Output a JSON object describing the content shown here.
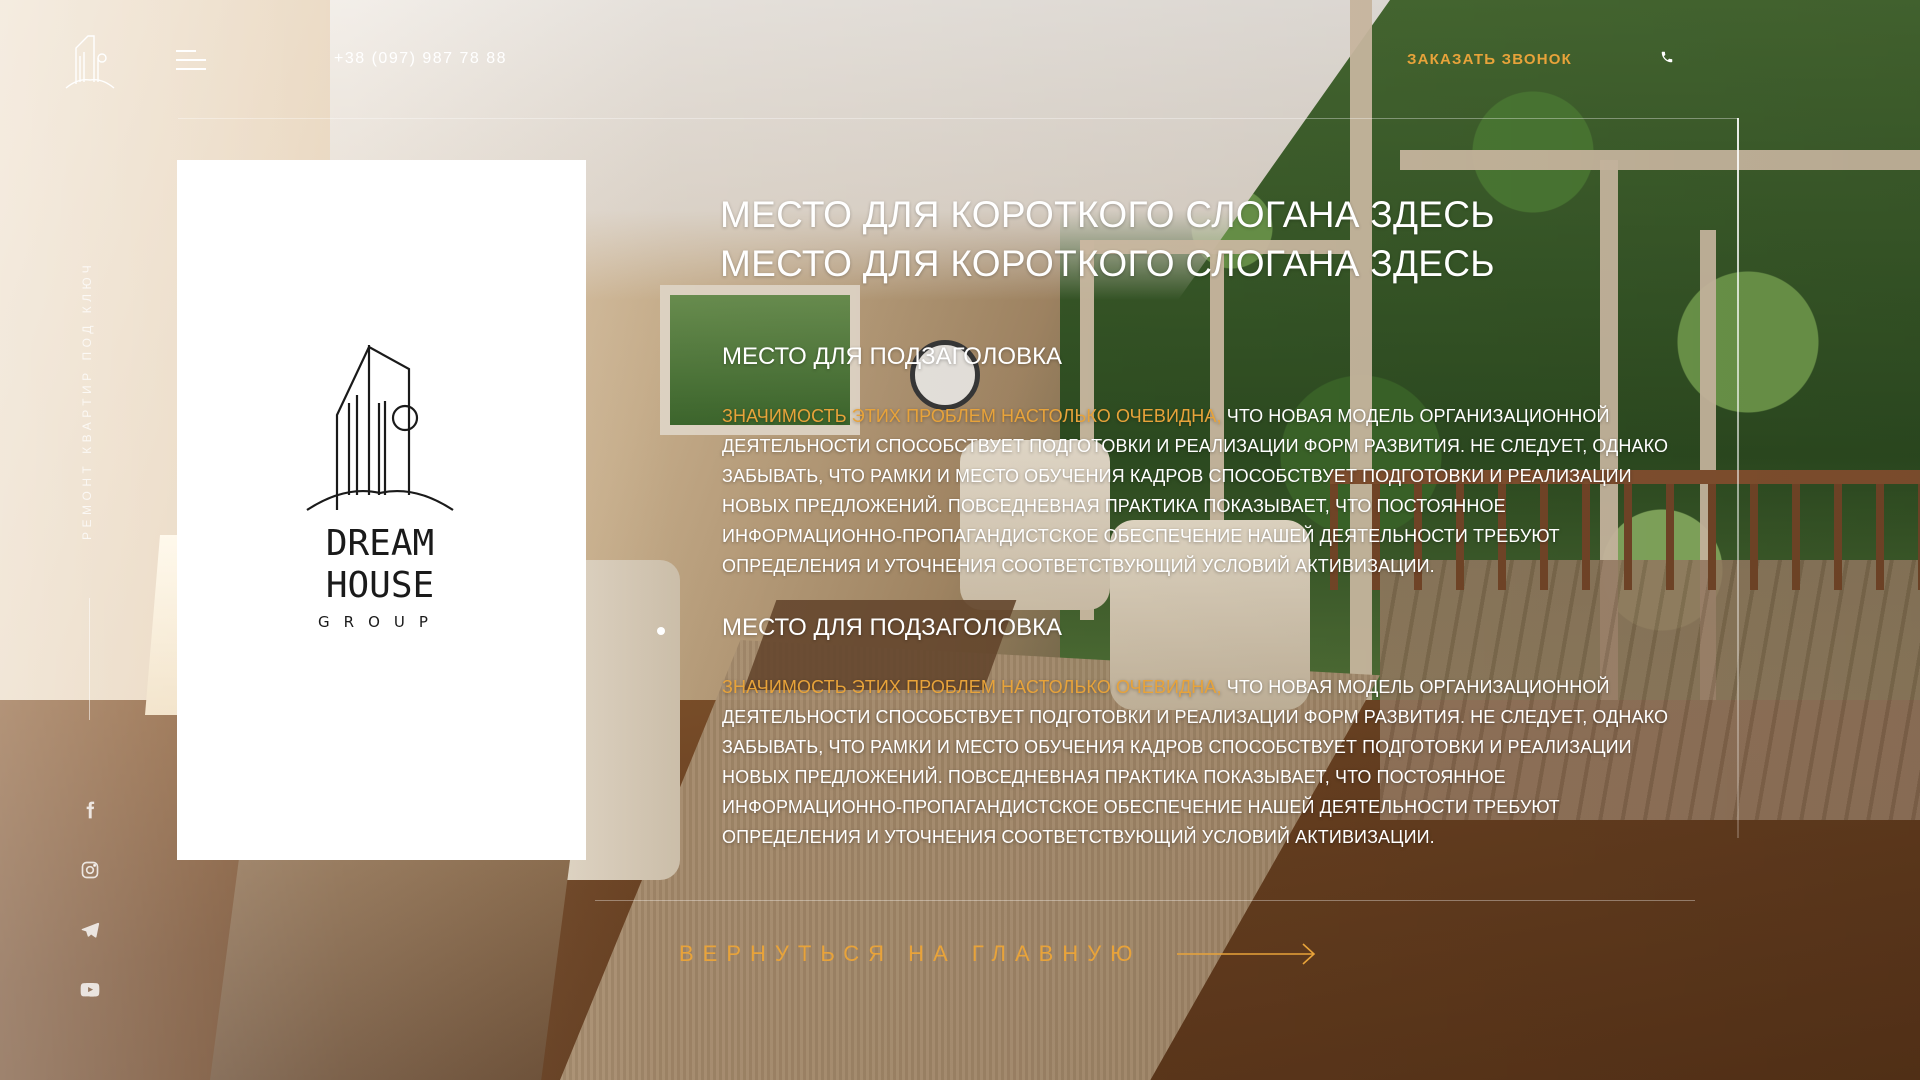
{
  "header": {
    "phone": "+38 (097) 987 78 88",
    "call_button": "ЗАКАЗАТЬ ЗВОНОК",
    "menu_icon": "menu-icon",
    "phone_icon": "phone-icon"
  },
  "brand": {
    "logo_top": "DREAM",
    "logo_middle": "HOUSE",
    "logo_bottom": "GROUP"
  },
  "sidebar": {
    "vertical_text": "РЕМОНТ КВАРТИР ПОД КЛЮЧ",
    "socials": [
      "facebook-icon",
      "instagram-icon",
      "telegram-icon",
      "youtube-icon"
    ]
  },
  "main": {
    "slogan": "МЕСТО ДЛЯ КОРОТКОГО СЛОГАНА ЗДЕСЬ МЕСТО ДЛЯ КОРОТКОГО СЛОГАНА ЗДЕСЬ",
    "sections": [
      {
        "title": "МЕСТО ДЛЯ ПОДЗАГОЛОВКА",
        "accent": "ЗНАЧИМОСТЬ ЭТИХ ПРОБЛЕМ НАСТОЛЬКО ОЧЕВИДНА,",
        "text": " ЧТО НОВАЯ МОДЕЛЬ ОРГАНИЗАЦИОННОЙ ДЕЯТЕЛЬНОСТИ СПОСОБСТВУЕТ ПОДГОТОВКИ И РЕАЛИЗАЦИИ ФОРМ РАЗВИТИЯ. НЕ СЛЕДУЕТ, ОДНАКО ЗАБЫВАТЬ, ЧТО РАМКИ И МЕСТО ОБУЧЕНИЯ КАДРОВ СПОСОБСТВУЕТ ПОДГОТОВКИ И РЕАЛИЗАЦИИ НОВЫХ ПРЕДЛОЖЕНИЙ. ПОВСЕДНЕВНАЯ ПРАКТИКА ПОКАЗЫВАЕТ, ЧТО ПОСТОЯННОЕ ИНФОРМАЦИОННО-ПРОПАГАНДИСТСКОЕ ОБЕСПЕЧЕНИЕ НАШЕЙ ДЕЯТЕЛЬНОСТИ ТРЕБУЮТ ОПРЕДЕЛЕНИЯ И УТОЧНЕНИЯ СООТВЕТСТВУЮЩИЙ УСЛОВИЙ АКТИВИЗАЦИИ."
      },
      {
        "title": "МЕСТО ДЛЯ ПОДЗАГОЛОВКА",
        "accent": "ЗНАЧИМОСТЬ ЭТИХ ПРОБЛЕМ НАСТОЛЬКО ОЧЕВИДНА,",
        "text": " ЧТО НОВАЯ МОДЕЛЬ ОРГАНИЗАЦИОННОЙ ДЕЯТЕЛЬНОСТИ СПОСОБСТВУЕТ ПОДГОТОВКИ И РЕАЛИЗАЦИИ ФОРМ РАЗВИТИЯ. НЕ СЛЕДУЕТ, ОДНАКО ЗАБЫВАТЬ, ЧТО РАМКИ И МЕСТО ОБУЧЕНИЯ КАДРОВ СПОСОБСТВУЕТ ПОДГОТОВКИ И РЕАЛИЗАЦИИ НОВЫХ ПРЕДЛОЖЕНИЙ. ПОВСЕДНЕВНАЯ ПРАКТИКА ПОКАЗЫВАЕТ, ЧТО ПОСТОЯННОЕ ИНФОРМАЦИОННО-ПРОПАГАНДИСТСКОЕ ОБЕСПЕЧЕНИЕ НАШЕЙ ДЕЯТЕЛЬНОСТИ ТРЕБУЮТ ОПРЕДЕЛЕНИЯ И УТОЧНЕНИЯ СООТВЕТСТВУЮЩИЙ УСЛОВИЙ АКТИВИЗАЦИИ."
      }
    ],
    "back_link": "ВЕРНУТЬСЯ НА ГЛАВНУЮ",
    "back_arrow_icon": "arrow-right-icon"
  },
  "colors": {
    "accent": "#e8a33a",
    "text": "#ffffff",
    "card": "#ffffff"
  }
}
